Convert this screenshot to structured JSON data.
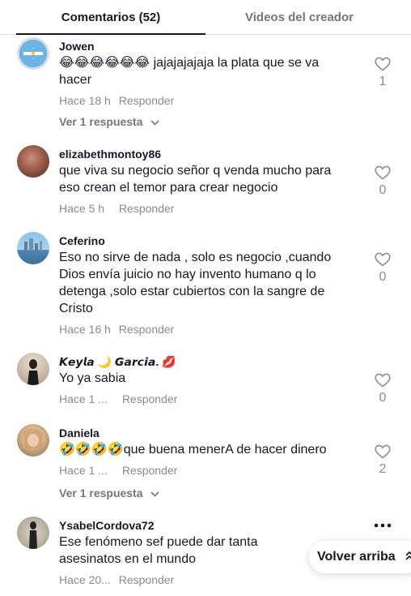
{
  "tabs": [
    {
      "label": "Comentarios (52)",
      "active": true
    },
    {
      "label": "Videos del creador",
      "active": false
    }
  ],
  "comments": [
    {
      "username": "Jowen",
      "text": "😂😂😂😂😂😂 jajajajajaja la plata que se va hacer",
      "time": "Hace 18 h",
      "reply_label": "Responder",
      "likes": "1",
      "view_replies": "Ver 1 respuesta"
    },
    {
      "username": "elizabethmontoy86",
      "text": "que viva su negocio señor q venda mucho para eso crean el temor para crear negocio",
      "time": "Hace 5 h",
      "reply_label": "Responder",
      "likes": "0"
    },
    {
      "username": "Ceferino",
      "text": "Eso no sirve de nada , solo es negocio ,cuando Dios envía juicio no hay invento humano q lo detenga ,solo estar cubiertos con la sangre de Cristo",
      "time": "Hace 16 h",
      "reply_label": "Responder",
      "likes": "0"
    },
    {
      "username": "𝙆𝙚𝙮𝙡𝙖 🌙 𝙂𝙖𝙧𝙘𝙞𝙖. 💋",
      "text": "Yo ya sabia",
      "time": "Hace 1 ...",
      "reply_label": "Responder",
      "likes": "0"
    },
    {
      "username": "Daniela",
      "text": "🤣🤣🤣🤣que buena menerA de hacer dinero",
      "time": "Hace 1 ...",
      "reply_label": "Responder",
      "likes": "2",
      "view_replies": "Ver 1 respuesta"
    },
    {
      "username": "YsabelCordova72",
      "text": "Ese fenómeno sef puede dar tanta asesinatos en el mundo",
      "time": "Hace 20...",
      "reply_label": "Responder",
      "likes": ""
    }
  ],
  "back_to_top": {
    "label": "Volver arriba",
    "icon": "double-chevron-up-icon"
  },
  "icons": {
    "like": "heart-outline-icon",
    "more": "more-dots-icon",
    "chevron": "chevron-down-icon"
  },
  "colors": {
    "text_primary": "#161823",
    "text_secondary": "#8a8b91",
    "tab_underline": "#161823"
  }
}
